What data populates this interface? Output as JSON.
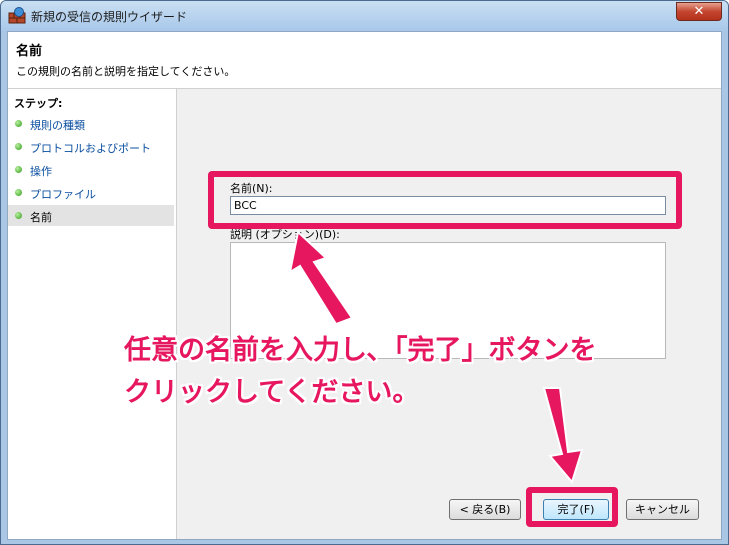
{
  "window": {
    "title": "新規の受信の規則ウイザード",
    "close_glyph": "✕"
  },
  "header": {
    "title": "名前",
    "subtitle": "この規則の名前と説明を指定してください。"
  },
  "steps": {
    "title": "ステップ:",
    "items": [
      {
        "label": "規則の種類"
      },
      {
        "label": "プロトコルおよびポート"
      },
      {
        "label": "操作"
      },
      {
        "label": "プロファイル"
      },
      {
        "label": "名前"
      }
    ],
    "current_index": 4
  },
  "form": {
    "name_label": "名前(N):",
    "name_value": "BCC",
    "description_label": "説明 (オプション)(D):",
    "description_value": ""
  },
  "buttons": {
    "back": "< 戻る(B)",
    "finish": "完了(F)",
    "cancel": "キャンセル"
  },
  "annotation": {
    "line1": "任意の名前を入力し､「完了」ボタンを",
    "line2": "クリックしてください。"
  },
  "colors": {
    "highlight": "#e6165f",
    "step_dot": "#2f9a18",
    "link": "#0b4fa0"
  }
}
